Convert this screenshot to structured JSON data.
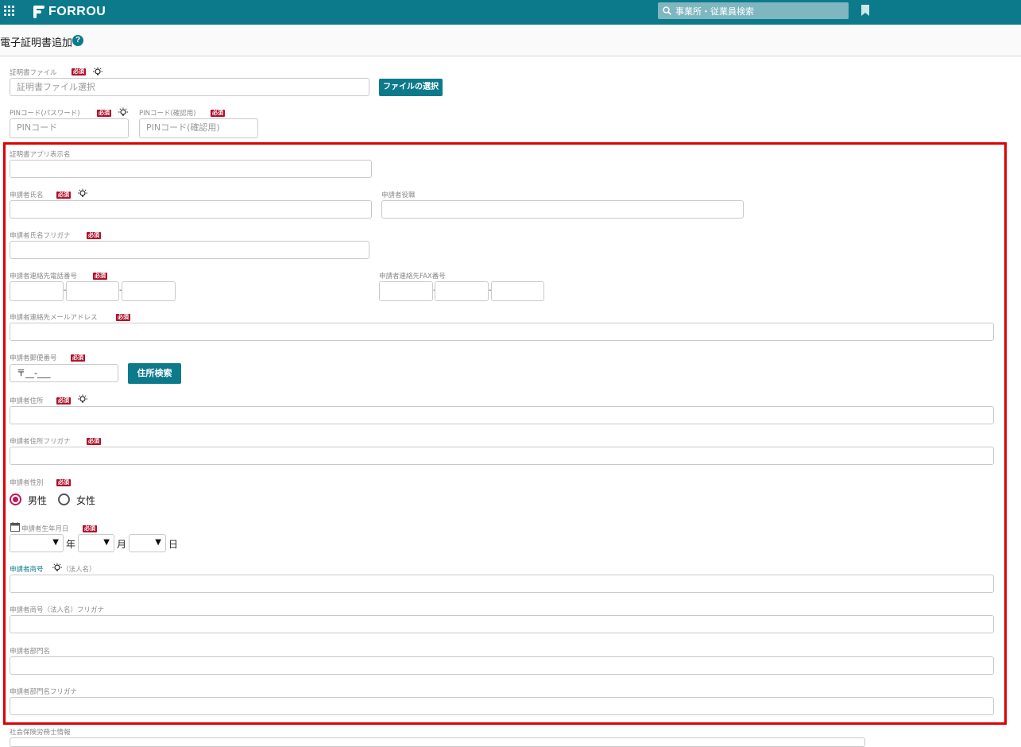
{
  "app": {
    "brand": "FORROU"
  },
  "topbar": {
    "search_label": "事業所・従業員検索"
  },
  "page": {
    "title": "電子証明書追加",
    "help": "?"
  },
  "required_badge": "必須",
  "form": {
    "cert_file": {
      "label": "証明書ファイル",
      "placeholder": "証明書ファイル選択",
      "button": "ファイルの選択"
    },
    "pin": {
      "label": "PINコード(パスワード)",
      "placeholder": "PINコード"
    },
    "pin_confirm": {
      "label": "PINコード(確認用)",
      "placeholder": "PINコード(確認用)"
    },
    "app_display_name": {
      "label": "証明書アプリ表示名"
    },
    "applicant_name": {
      "label": "申請者氏名"
    },
    "applicant_title": {
      "label": "申請者役職"
    },
    "applicant_name_kana": {
      "label": "申請者氏名フリガナ"
    },
    "applicant_phone": {
      "label": "申請者連絡先電話番号",
      "sep": "-"
    },
    "applicant_fax": {
      "label": "申請者連絡先FAX番号",
      "sep": "-"
    },
    "applicant_email": {
      "label": "申請者連絡先メールアドレス"
    },
    "applicant_zip": {
      "label": "申請者郵便番号",
      "value": "〒__-___",
      "button": "住所検索"
    },
    "applicant_address": {
      "label": "申請者住所"
    },
    "applicant_address_kana": {
      "label": "申請者住所フリガナ"
    },
    "applicant_gender": {
      "label": "申請者性別",
      "options": [
        "男性",
        "女性"
      ],
      "selected": "男性"
    },
    "applicant_birthdate": {
      "label": "申請者生年月日",
      "year_unit": "年",
      "month_unit": "月",
      "day_unit": "日",
      "arrow": "▼"
    },
    "applicant_company": {
      "label": "申請者商号",
      "note": "（法人名）"
    },
    "applicant_company_kana": {
      "label": "申請者商号（法人名）フリガナ"
    },
    "applicant_department": {
      "label": "申請者部門名"
    },
    "applicant_department_kana": {
      "label": "申請者部門名フリガナ"
    },
    "sharoushi_info": {
      "label": "社会保険労務士情報"
    }
  },
  "colors": {
    "brand": "#0d7a8c",
    "required": "#b0102a",
    "highlight": "#e00000",
    "radio": "#c2185b"
  }
}
